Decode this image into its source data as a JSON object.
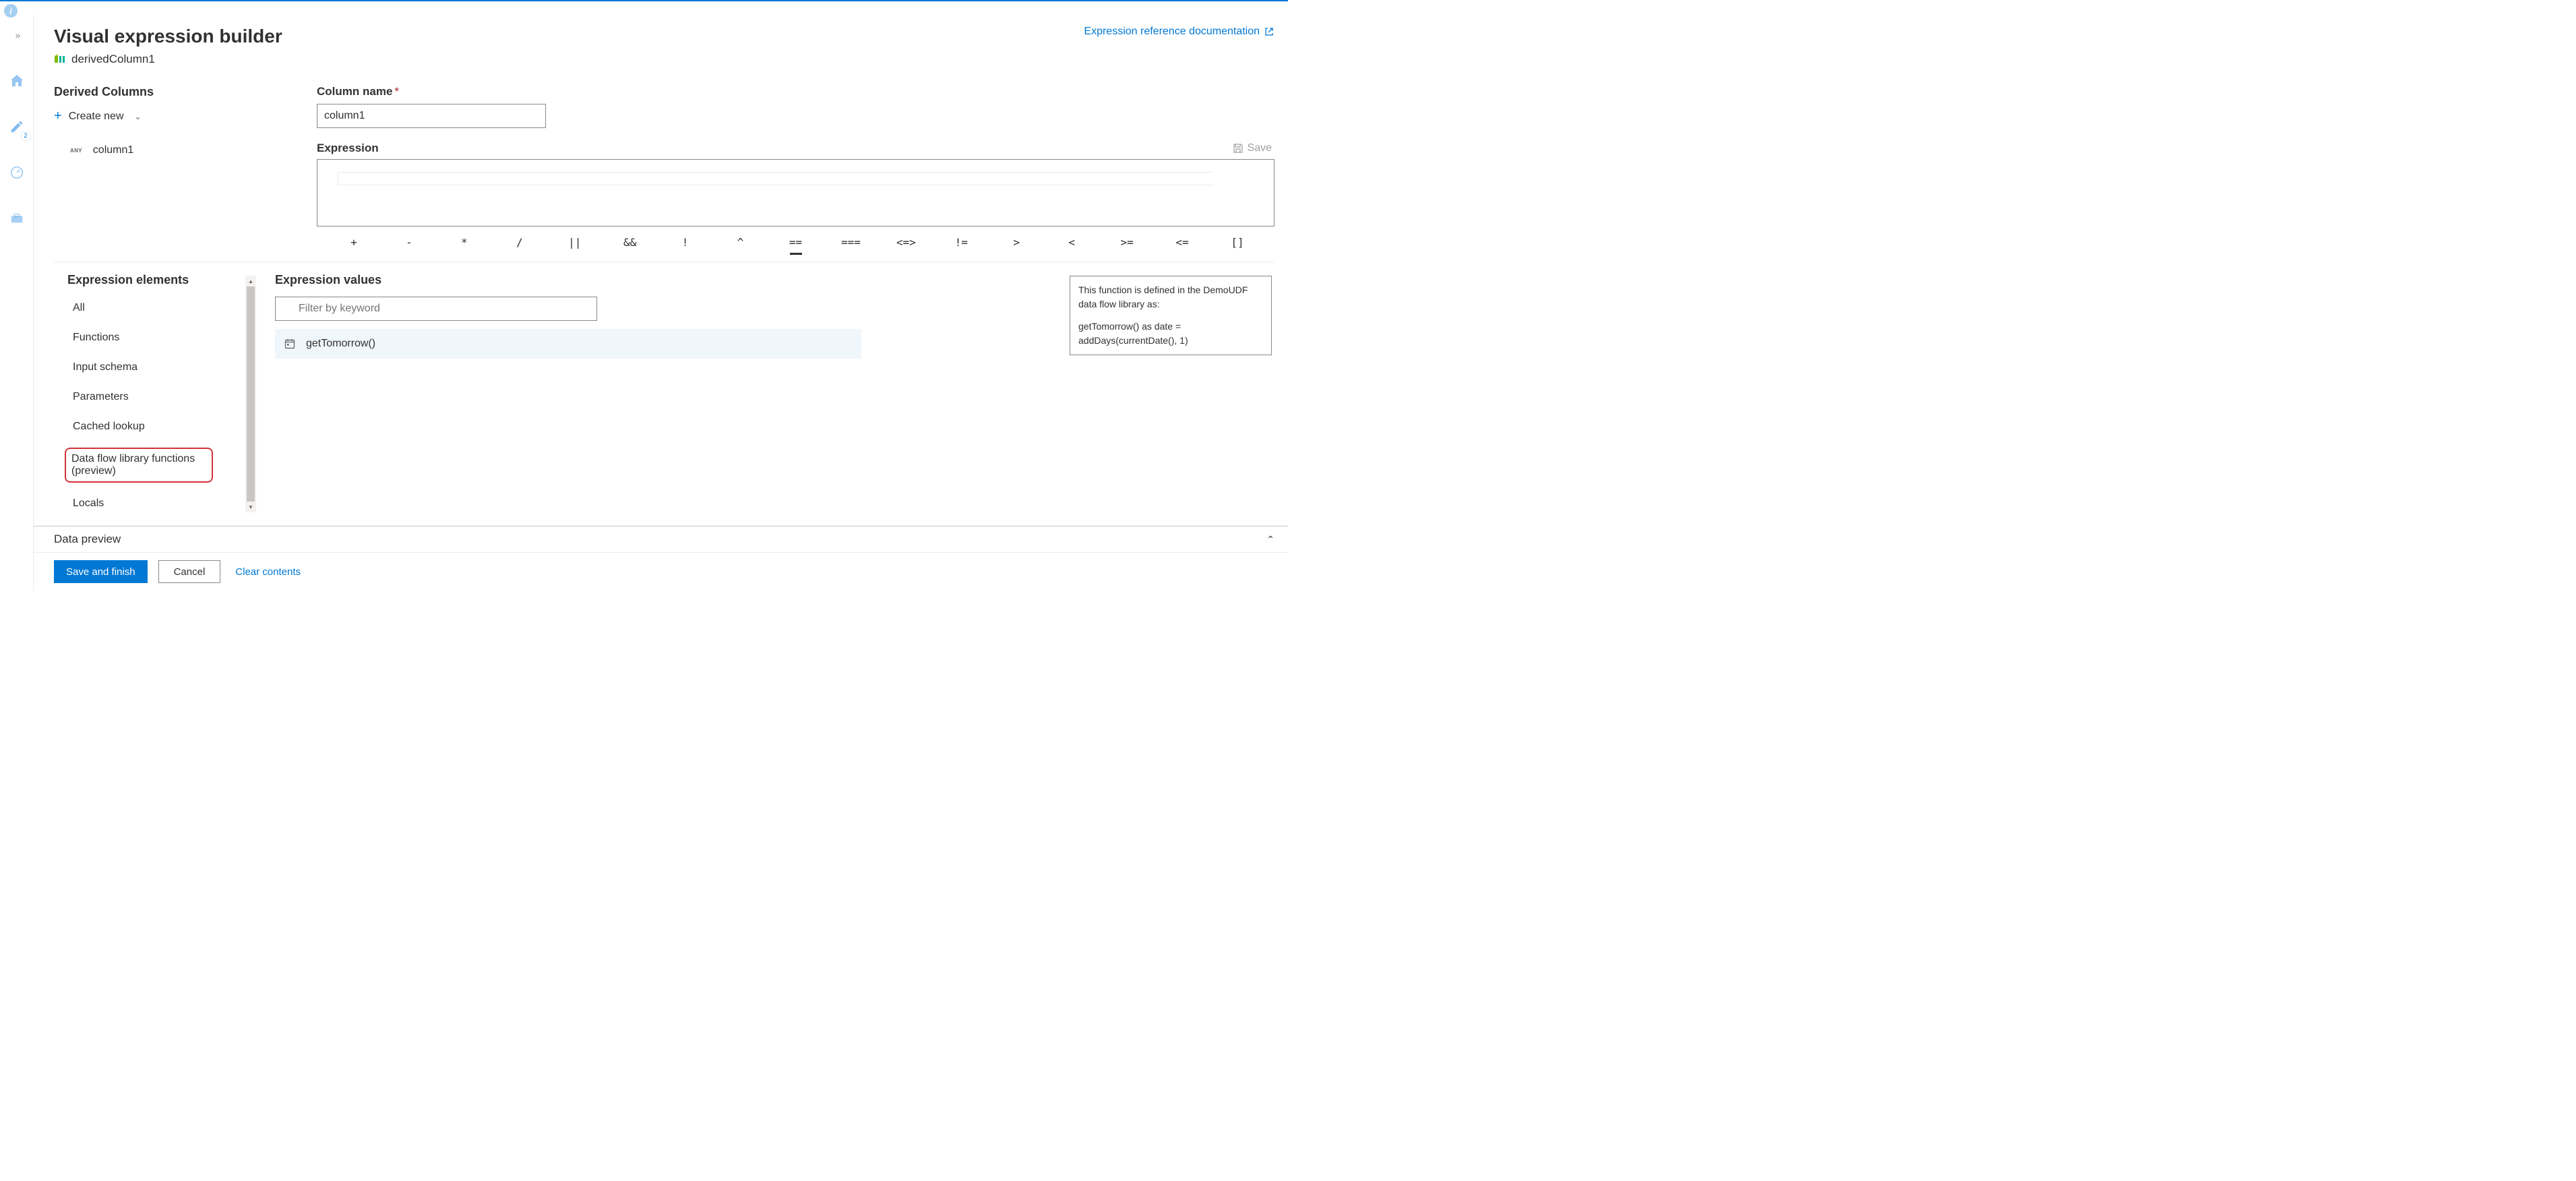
{
  "header": {
    "title": "Visual expression builder",
    "ref_link": "Expression reference documentation"
  },
  "transformation": {
    "name": "derivedColumn1"
  },
  "derived_panel": {
    "title": "Derived Columns",
    "create_new": "Create new",
    "columns": [
      {
        "type_tag": "ANY",
        "name": "column1"
      }
    ]
  },
  "form": {
    "column_name_label": "Column name",
    "column_name_value": "column1",
    "expression_label": "Expression",
    "save_label": "Save",
    "expression_value": "",
    "operators": [
      "+",
      "-",
      "*",
      "/",
      "||",
      "&&",
      "!",
      "^",
      "==",
      "===",
      "<=>",
      "!=",
      ">",
      "<",
      ">=",
      "<=",
      "[]"
    ]
  },
  "elements": {
    "title": "Expression elements",
    "items": [
      "All",
      "Functions",
      "Input schema",
      "Parameters",
      "Cached lookup",
      "Data flow library functions (preview)",
      "Locals"
    ],
    "highlighted_index": 5
  },
  "values": {
    "title": "Expression values",
    "filter_placeholder": "Filter by keyword",
    "functions": [
      {
        "name": "getTomorrow()"
      }
    ],
    "tooltip": {
      "line1": "This function is defined in the DemoUDF data flow library as:",
      "line2": "getTomorrow() as date = addDays(currentDate(), 1)"
    }
  },
  "preview": {
    "title": "Data preview"
  },
  "footer": {
    "save_finish": "Save and finish",
    "cancel": "Cancel",
    "clear": "Clear contents"
  }
}
